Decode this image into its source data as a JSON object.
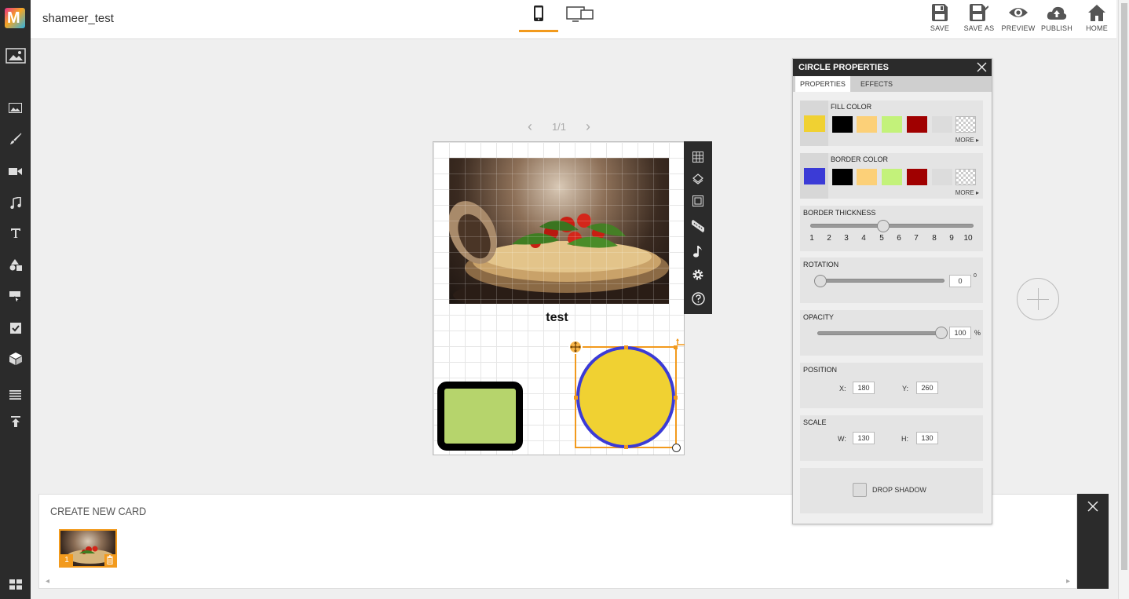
{
  "app": {
    "logo_letter": "M",
    "project_title": "shameer_test"
  },
  "left_toolbar": {
    "items": [
      "background-icon",
      "image-icon",
      "brush-icon",
      "video-icon",
      "audio-icon",
      "text-icon",
      "shapes-icon",
      "widget-icon",
      "quiz-icon",
      "3d-box-icon",
      "list-icon",
      "upload-icon",
      "grid-view-icon"
    ]
  },
  "devices": {
    "mobile": "mobile-device-icon",
    "desktop": "desktop-tablet-device-icon",
    "active": "mobile"
  },
  "actions": {
    "save": "SAVE",
    "save_as": "SAVE AS",
    "preview": "PREVIEW",
    "publish": "PUBLISH",
    "home": "HOME"
  },
  "pager": {
    "prev": "‹",
    "label": "1/1",
    "next": "›"
  },
  "card": {
    "text": "test",
    "rect_fill": "#b6d46c",
    "rect_border": "#000000",
    "circle_fill": "#f0d132",
    "circle_border": "#3b3bd6"
  },
  "side_tools": [
    "grid-icon",
    "layers-icon",
    "frame-icon",
    "ruler-icon",
    "music-note-icon",
    "settings-icon",
    "help-icon"
  ],
  "strip": {
    "title": "CREATE NEW CARD",
    "cards": [
      {
        "number": "1"
      }
    ]
  },
  "panel": {
    "title": "CIRCLE PROPERTIES",
    "tabs": {
      "properties": "PROPERTIES",
      "effects": "EFFECTS",
      "active": "properties"
    },
    "fill": {
      "title": "FILL COLOR",
      "current": "#f0d132",
      "swatches": [
        "#000000",
        "#fcd078",
        "#c3f27a",
        "#a00000",
        "#dcdcdc",
        "transparent"
      ],
      "more": "MORE"
    },
    "border": {
      "title": "BORDER COLOR",
      "current": "#3b3bd6",
      "swatches": [
        "#000000",
        "#fcd078",
        "#c3f27a",
        "#a00000",
        "#dcdcdc",
        "transparent"
      ],
      "more": "MORE"
    },
    "thickness": {
      "title": "BORDER THICKNESS",
      "ticks": [
        "1",
        "2",
        "3",
        "4",
        "5",
        "6",
        "7",
        "8",
        "9",
        "10"
      ],
      "value": 5
    },
    "rotation": {
      "title": "ROTATION",
      "value": "0",
      "unit": "0"
    },
    "opacity": {
      "title": "OPACITY",
      "value": "100",
      "unit": "%"
    },
    "position": {
      "title": "POSITION",
      "x_label": "X:",
      "x": "180",
      "y_label": "Y:",
      "y": "260"
    },
    "scale": {
      "title": "SCALE",
      "w_label": "W:",
      "w": "130",
      "h_label": "H:",
      "h": "130"
    },
    "drop_shadow": {
      "label": "DROP SHADOW",
      "checked": false
    }
  }
}
